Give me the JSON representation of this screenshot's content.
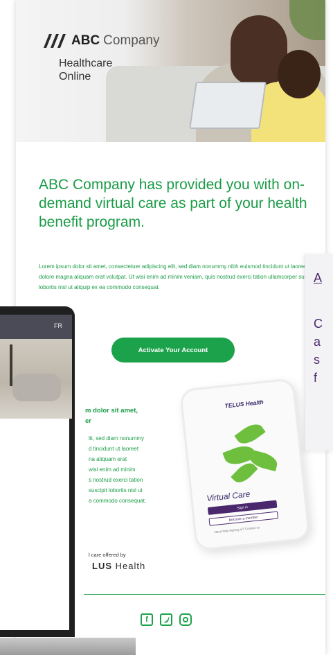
{
  "email": {
    "brand_strong": "ABC",
    "brand_light": "Company",
    "tagline_1": "Healthcare",
    "tagline_2": "Online",
    "headline": "ABC Company has provided you with on-demand virtual care as part of your health benefit program.",
    "body": "Lorem ipsum dolor sit amet, consectetuer adipiscing elit, sed diam nonummy nibh euismod tincidunt ut laoreet dolore magna aliquam erat volutpat. Ut wisi enim ad minim veniam, quis nostrud exerci tation ullamcorper suscipit lobortis nisl ut aliquip ex ea commodo consequat.",
    "cta_label": "Activate Your Account",
    "lower_title_1": "m dolor sit amet,",
    "lower_title_2": "er",
    "lower_lines": [
      "lit, sed diam nonummy",
      "d tincidunt ut laoreet",
      "na aliquam erat",
      "wisi enim ad minim",
      "s nostrud exerci tation",
      "suscipit lobortis nisl ut",
      "a commodo consequat."
    ],
    "offered_by": "l care offered by",
    "telus_strong": "LUS",
    "telus_light": "Health"
  },
  "phone": {
    "brand": "TELUS Health",
    "virtual_care": "Virtual Care",
    "sign_in": "Sign in",
    "become_member": "Become a member",
    "footer": "Need help signing in? Contact us"
  },
  "laptop": {
    "lang": "FR"
  },
  "overlay": {
    "lines": [
      "A",
      "C",
      "a",
      "s",
      "f"
    ]
  },
  "socials": [
    "facebook-icon",
    "twitter-icon",
    "instagram-icon"
  ],
  "colors": {
    "green": "#1ca24b",
    "purple": "#4b286d"
  }
}
